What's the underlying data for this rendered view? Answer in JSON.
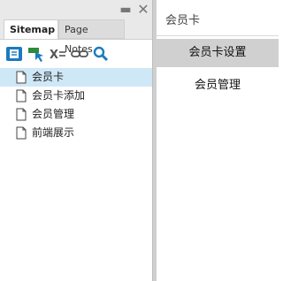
{
  "sitemap_panel": {
    "tabs": [
      {
        "label": "Sitemap"
      },
      {
        "label": "Page Notes"
      }
    ],
    "minimize_glyph": "▬",
    "close_glyph": "✕",
    "toolbar": {
      "icons": [
        "add-page-icon",
        "add-child-icon",
        "delete-icon",
        "link-icon",
        "search-icon"
      ],
      "accent_color": "#1a7bbf"
    },
    "pages": [
      {
        "label": "会员卡",
        "selected": true
      },
      {
        "label": "会员卡添加",
        "selected": false
      },
      {
        "label": "会员管理",
        "selected": false
      },
      {
        "label": "前端展示",
        "selected": false
      }
    ]
  },
  "preview": {
    "title": "会员卡",
    "menu": [
      {
        "label": "会员卡设置",
        "active": true
      },
      {
        "label": "会员管理",
        "active": false
      }
    ]
  }
}
